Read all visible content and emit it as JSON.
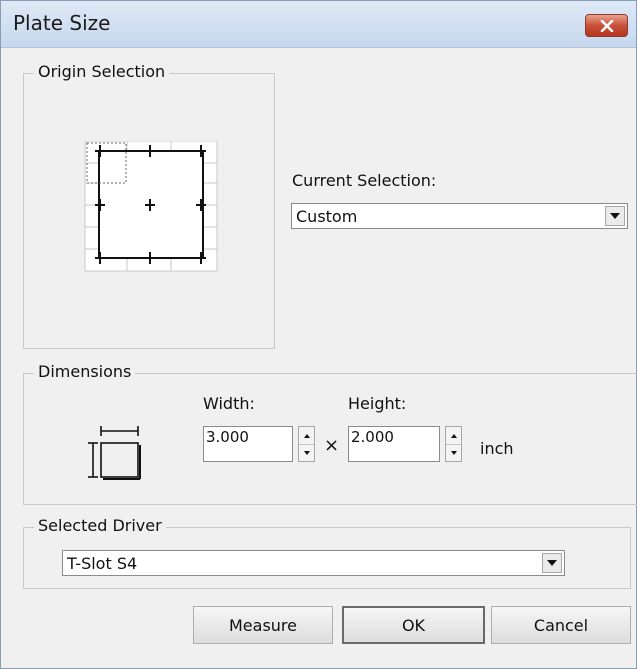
{
  "window": {
    "title": "Plate Size"
  },
  "origin": {
    "legend": "Origin Selection",
    "current_selection_label": "Current Selection:",
    "current_selection_value": "Custom"
  },
  "dimensions": {
    "legend": "Dimensions",
    "width_label": "Width:",
    "height_label": "Height:",
    "width_value": "3.000",
    "height_value": "2.000",
    "times_symbol": "×",
    "unit": "inch"
  },
  "driver": {
    "legend": "Selected Driver",
    "value": "T-Slot S4"
  },
  "buttons": {
    "measure": "Measure",
    "ok": "OK",
    "cancel": "Cancel"
  },
  "icons": {
    "close": "close-icon",
    "dropdown": "chevron-down-icon",
    "spin_up": "spin-up-icon",
    "spin_down": "spin-down-icon",
    "origin_grid": "origin-grid-icon",
    "plate_dimensions": "plate-dimensions-icon"
  },
  "colors": {
    "title_gradient_top": "#dfe9f6",
    "title_gradient_bottom": "#c6d7ee",
    "close_button": "#c8513a",
    "dialog_background": "#f0f0f0"
  }
}
